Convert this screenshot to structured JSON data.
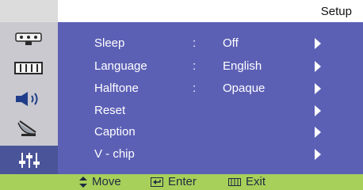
{
  "header": {
    "title": "Setup"
  },
  "sidebar": {
    "items": [
      {
        "icon": "input-connector-icon"
      },
      {
        "icon": "picture-grid-icon"
      },
      {
        "icon": "speaker-icon"
      },
      {
        "icon": "satellite-dish-icon"
      },
      {
        "icon": "equalizer-sliders-icon"
      }
    ],
    "active_index": 4
  },
  "menu": {
    "rows": [
      {
        "label": "Sleep",
        "colon": ":",
        "value": "Off"
      },
      {
        "label": "Language",
        "colon": ":",
        "value": "English"
      },
      {
        "label": "Halftone",
        "colon": ":",
        "value": "Opaque"
      },
      {
        "label": "Reset",
        "colon": "",
        "value": ""
      },
      {
        "label": "Caption",
        "colon": "",
        "value": ""
      },
      {
        "label": "V - chip",
        "colon": "",
        "value": ""
      }
    ]
  },
  "footer": {
    "move": "Move",
    "enter": "Enter",
    "exit": "Exit"
  },
  "colors": {
    "panel": "#5c60b5",
    "sidebar": "#c9c9cf",
    "active": "#4a5498",
    "footer": "#a7d05a"
  }
}
